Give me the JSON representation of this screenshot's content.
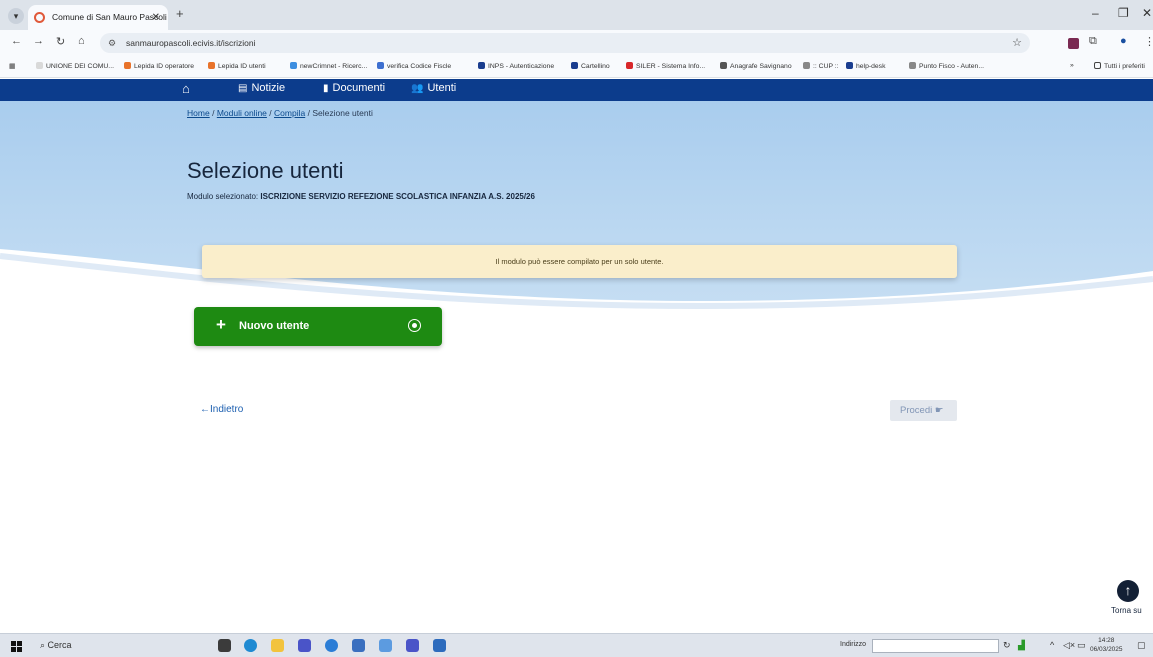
{
  "browser": {
    "tab_title": "Comune di San Mauro Pascoli",
    "url": "sanmauropascoli.ecivis.it/iscrizioni",
    "bookmarks": [
      "UNIONE DEI COMU...",
      "Lepida ID operatore",
      "Lepida ID utenti",
      "newCrimnet - Ricerc...",
      "verifica Codice Fiscle",
      "INPS - Autenticazione",
      "Cartellino",
      "SILER - Sistema Info...",
      "Anagrafe Savignano",
      ":: CUP ::",
      "help-desk",
      "Punto Fisco - Auten..."
    ],
    "all_bookmarks": "Tutti i preferiti"
  },
  "nav": {
    "items": [
      "Notizie",
      "Documenti",
      "Utenti"
    ]
  },
  "breadcrumb": {
    "home": "Home",
    "modules": "Moduli online",
    "compile": "Compila",
    "current": "Selezione utenti",
    "sep": "/"
  },
  "page": {
    "title": "Selezione utenti",
    "subtitle_prefix": "Modulo selezionato:",
    "subtitle_module": "ISCRIZIONE SERVIZIO REFEZIONE SCOLASTICA INFANZIA A.S. 2025/26",
    "notice": "Il modulo può essere compilato per un solo utente.",
    "new_user_label": "Nuovo utente",
    "back_label": "Indietro",
    "proceed_label": "Procedi",
    "top_label": "Torna su"
  },
  "taskbar": {
    "search_label": "Cerca",
    "address_label": "Indirizzo",
    "time": "14:28",
    "date": "06/03/2025"
  },
  "colors": {
    "nav_bg": "#0c3c8c",
    "hero_bg": "#b9d6f0",
    "notice_bg": "#faeecb",
    "primary_green": "#1e8a12",
    "link_blue": "#1c5fb0"
  }
}
